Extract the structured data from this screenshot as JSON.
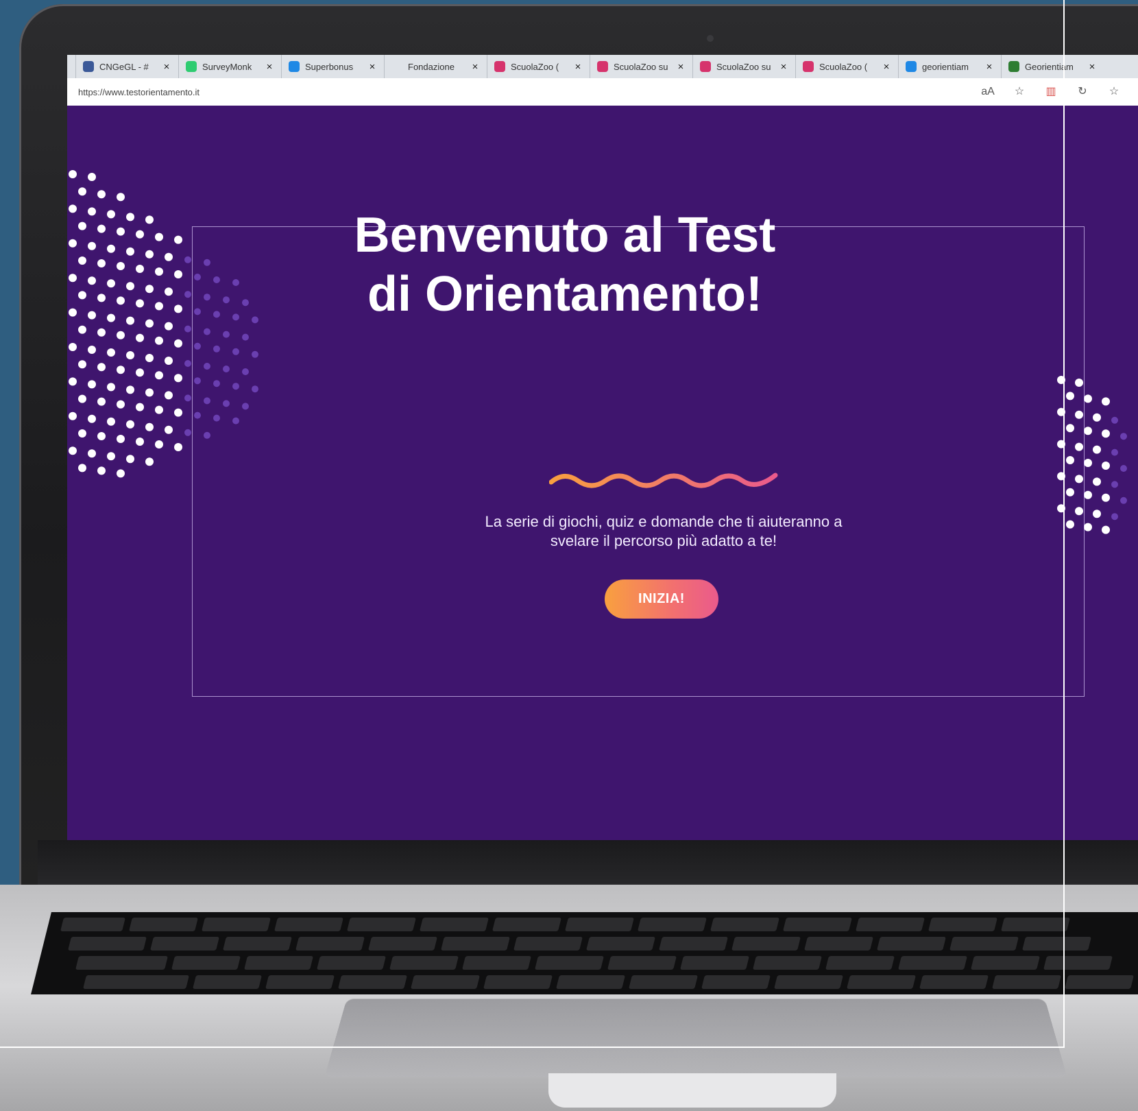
{
  "browser": {
    "tabs": [
      {
        "title": "CNGeGL - #",
        "icon": "wordpress-icon",
        "color": "#3b5998"
      },
      {
        "title": "SurveyMonk",
        "icon": "surveymonkey-icon",
        "color": "#2ecc71"
      },
      {
        "title": "Superbonus",
        "icon": "checkbox-icon",
        "color": "#1e88e5"
      },
      {
        "title": "Fondazione",
        "icon": "",
        "color": ""
      },
      {
        "title": "ScuolaZoo (",
        "icon": "instagram-icon",
        "color": "#d6336c"
      },
      {
        "title": "ScuolaZoo su",
        "icon": "instagram-icon",
        "color": "#d6336c"
      },
      {
        "title": "ScuolaZoo su",
        "icon": "instagram-icon",
        "color": "#d6336c"
      },
      {
        "title": "ScuolaZoo (",
        "icon": "instagram-icon",
        "color": "#d6336c"
      },
      {
        "title": "georientiam",
        "icon": "bing-icon",
        "color": "#1e88e5"
      },
      {
        "title": "Georientiam",
        "icon": "image-icon",
        "color": "#2e7d32"
      }
    ],
    "url": "https://www.testorientamento.it"
  },
  "hero": {
    "title_line1": "Benvenuto al Test",
    "title_line2": "di Orientamento!",
    "subtitle_line1": "La serie di giochi, quiz e domande che ti aiuteranno a",
    "subtitle_line2": "svelare il percorso più adatto a te!",
    "cta_label": "INIZIA!"
  },
  "colors": {
    "page_background": "#3f156e",
    "cta_gradient_start": "#f9a03f",
    "cta_gradient_end": "#ea5a8c"
  }
}
